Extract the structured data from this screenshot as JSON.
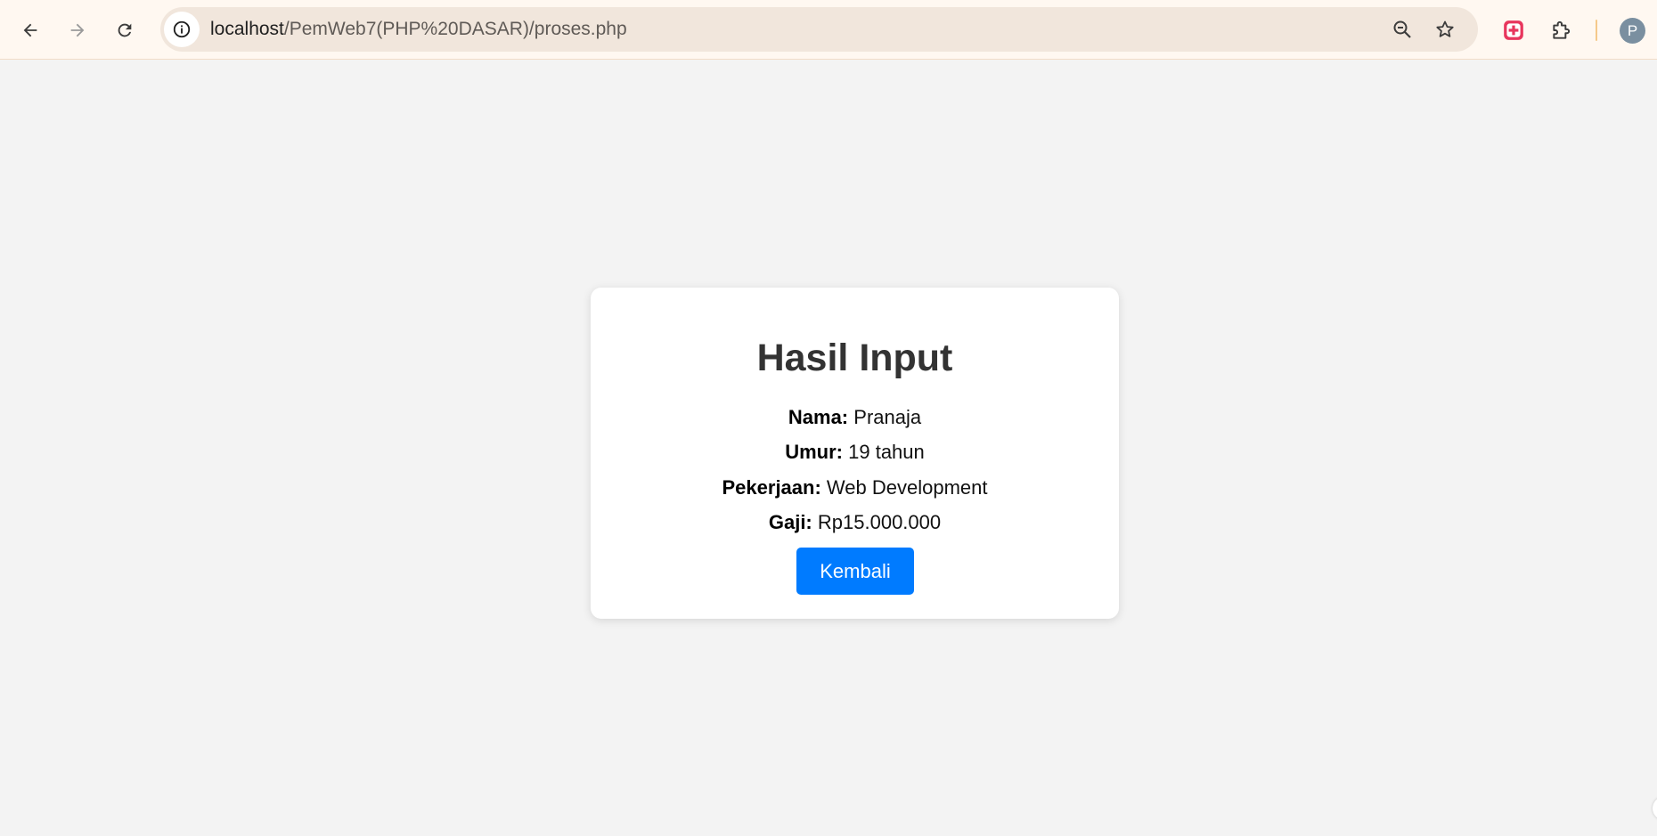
{
  "browser": {
    "url_host": "localhost",
    "url_path": "/PemWeb7(PHP%20DASAR)/proses.php",
    "avatar_letter": "P",
    "icons": {
      "back": "arrow-left-icon",
      "forward": "arrow-right-icon",
      "reload": "reload-icon",
      "site_info": "info-icon",
      "zoom": "zoom-out-icon",
      "bookmark": "star-icon",
      "extension": "red-cross-extension-icon",
      "extensions_menu": "puzzle-icon"
    }
  },
  "card": {
    "title": "Hasil Input",
    "fields": [
      {
        "label": "Nama:",
        "value": "Pranaja"
      },
      {
        "label": "Umur:",
        "value": "19 tahun"
      },
      {
        "label": "Pekerjaan:",
        "value": "Web Development"
      },
      {
        "label": "Gaji:",
        "value": "Rp15.000.000"
      }
    ],
    "button_label": "Kembali"
  },
  "colors": {
    "page_bg": "#f3f3f3",
    "button_bg": "#007bff",
    "title": "#333333"
  }
}
